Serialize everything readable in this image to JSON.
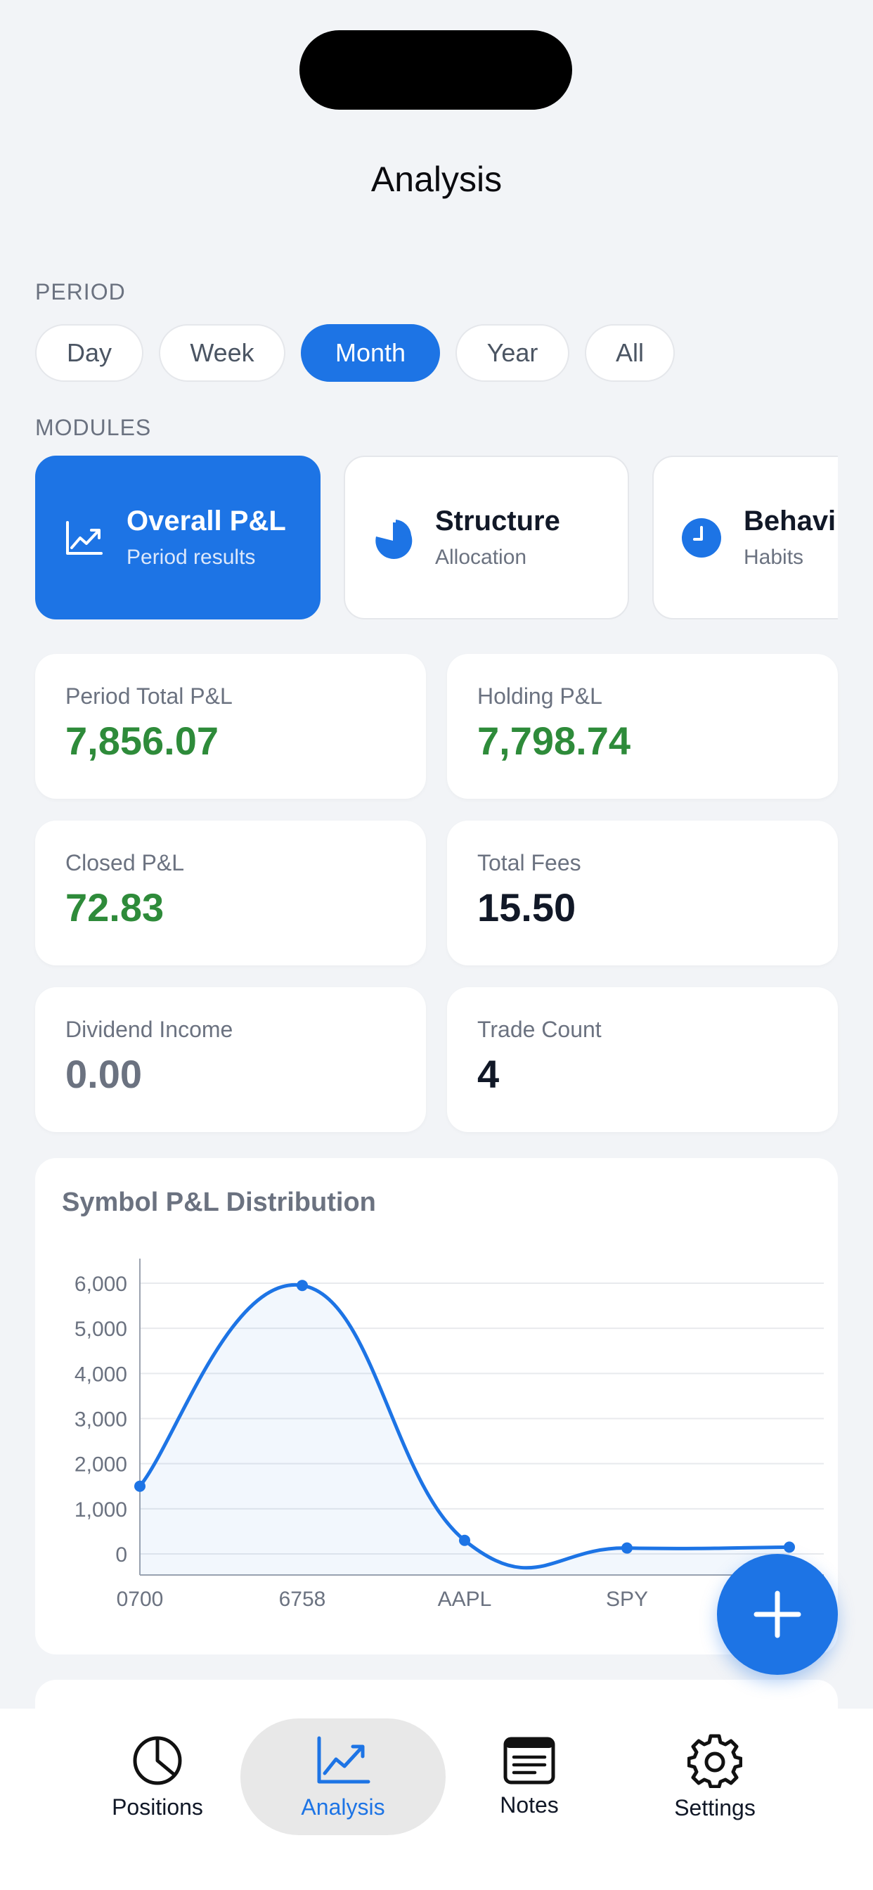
{
  "header": {
    "title": "Analysis"
  },
  "period": {
    "label": "PERIOD",
    "options": [
      "Day",
      "Week",
      "Month",
      "Year",
      "All"
    ],
    "selected": "Month"
  },
  "modules": {
    "label": "MODULES",
    "items": [
      {
        "title": "Overall P&L",
        "subtitle": "Period results",
        "icon": "trend-up-icon",
        "active": true
      },
      {
        "title": "Structure",
        "subtitle": "Allocation",
        "icon": "pie-chart-icon",
        "active": false
      },
      {
        "title": "Behavi",
        "subtitle": "Habits",
        "icon": "clock-icon",
        "active": false
      }
    ]
  },
  "stats": [
    {
      "label": "Period Total P&L",
      "value": "7,856.07",
      "tone": "positive"
    },
    {
      "label": "Holding P&L",
      "value": "7,798.74",
      "tone": "positive"
    },
    {
      "label": "Closed P&L",
      "value": "72.83",
      "tone": "positive"
    },
    {
      "label": "Total Fees",
      "value": "15.50",
      "tone": "neutral"
    },
    {
      "label": "Dividend Income",
      "value": "0.00",
      "tone": "zero"
    },
    {
      "label": "Trade Count",
      "value": "4",
      "tone": "neutral"
    }
  ],
  "chart_data": {
    "type": "line",
    "title": "Symbol P&L Distribution",
    "categories": [
      "0700",
      "6758",
      "AAPL",
      "SPY",
      ""
    ],
    "values": [
      1500,
      5950,
      300,
      130,
      150
    ],
    "ylim": [
      0,
      6000
    ],
    "yticks": [
      0,
      1000,
      2000,
      3000,
      4000,
      5000,
      6000
    ],
    "ytick_labels": [
      "0",
      "1,000",
      "2,000",
      "3,000",
      "4,000",
      "5,000",
      "6,000"
    ],
    "grid": true,
    "smooth": true,
    "area_fill": true,
    "color": "#1D74E5"
  },
  "fab": {
    "icon": "plus-icon"
  },
  "tabbar": {
    "items": [
      {
        "label": "Positions",
        "icon": "pie-chart-outline-icon",
        "active": false
      },
      {
        "label": "Analysis",
        "icon": "trend-chart-icon",
        "active": true
      },
      {
        "label": "Notes",
        "icon": "notes-icon",
        "active": false
      },
      {
        "label": "Settings",
        "icon": "gear-icon",
        "active": false
      }
    ]
  },
  "colors": {
    "accent": "#1D74E5",
    "positive": "#2E8B3A",
    "background": "#F2F4F7"
  }
}
